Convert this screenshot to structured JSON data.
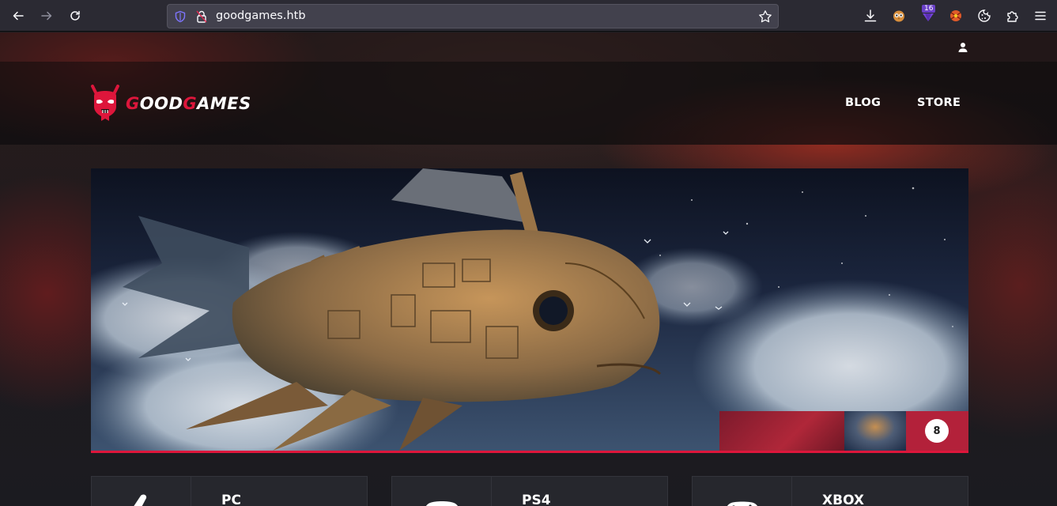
{
  "browser": {
    "url": "goodgames.htb",
    "extension_badge": "16"
  },
  "site": {
    "logo_prefix_1": "G",
    "logo_part_1": "OOD",
    "logo_prefix_2": "G",
    "logo_part_2": "AMES",
    "nav": {
      "blog": "BLOG",
      "store": "STORE"
    },
    "hero": {
      "thumbnail_count": "8"
    },
    "platforms": [
      {
        "label": "PC",
        "icon": "pc-icon"
      },
      {
        "label": "PS4",
        "icon": "gamepad-icon"
      },
      {
        "label": "XBOX",
        "icon": "xbox-controller-icon"
      }
    ]
  },
  "colors": {
    "accent": "#dd163b",
    "nav_background": "#0e0c0e",
    "card_background": "#26272d"
  }
}
